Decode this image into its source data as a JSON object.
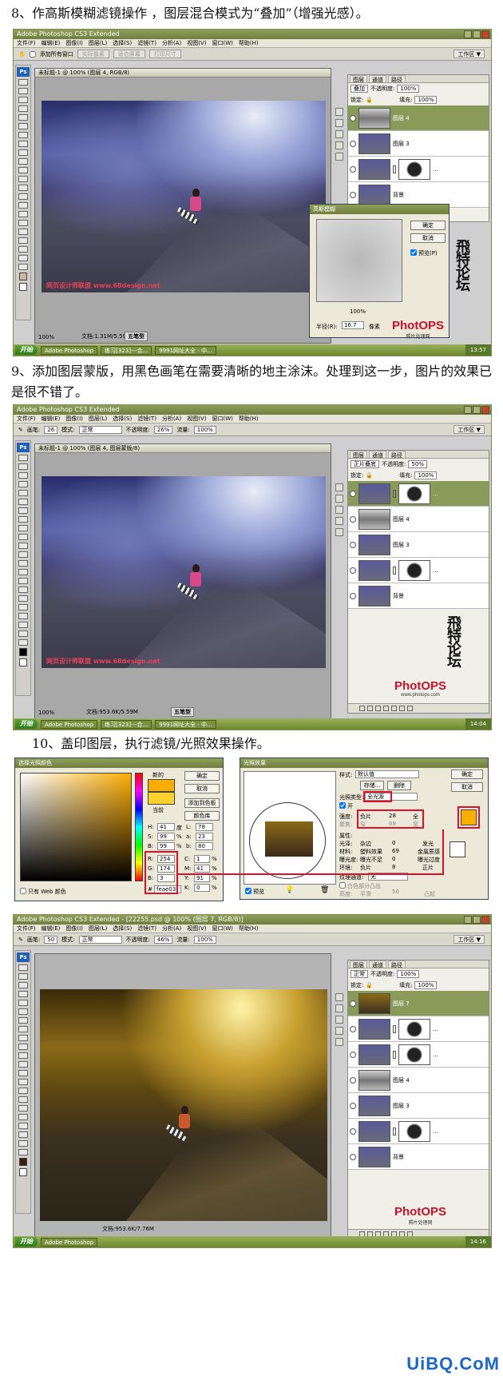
{
  "captions": {
    "step8": "8、作高斯模糊滤镜操作 ，图层混合模式为“叠加”（增强光感）。",
    "step9": "9、添加图层蒙版，用黑色画笔在需要清晰的地主涂沫。处理到这一步，图片的效果已是很不错了。",
    "step10": "10、盖印图层，执行滤镜/光照效果操作。"
  },
  "app": {
    "title": "Adobe Photoshop CS3 Extended",
    "title4": "Adobe Photoshop CS3 Extended - [22255.psd @ 100% (图层 7, RGB/8)]",
    "menu": [
      "文件(F)",
      "编辑(E)",
      "图像(I)",
      "图层(L)",
      "选择(S)",
      "滤镜(T)",
      "分析(A)",
      "视图(V)",
      "窗口(W)",
      "帮助(H)"
    ],
    "workspace": "工作区 ▼",
    "ps_logo": "Ps"
  },
  "shot1": {
    "options": {
      "checkbox": "添加所有窗口",
      "btn1": "实际像素",
      "btn2": "适合屏幕",
      "btn3": "打印尺寸"
    },
    "doc_title": "未标题-1 @ 100% (图层 4, RGB/8)",
    "zoom": "100%",
    "doc_status": "文档:1.31M/5.59M",
    "nav": "五笔型",
    "watermark": "网页设计师联盟 www.68design.net",
    "layers": {
      "tabs": [
        "图层",
        "通道",
        "路径"
      ],
      "blend": "叠加",
      "opacity_label": "不透明度:",
      "opacity": "100%",
      "lock_label": "锁定:",
      "fill_label": "填充:",
      "fill": "100%",
      "items": [
        {
          "name": "图层 4"
        },
        {
          "name": "图层 3"
        },
        {
          "name": "..."
        },
        {
          "name": "背景"
        }
      ]
    },
    "gauss": {
      "title": "高斯模糊",
      "ok": "确定",
      "cancel": "取消",
      "preview": "预览(P)",
      "zoom": "100%",
      "radius_label": "半径(R):",
      "radius": "16.7",
      "unit": "像素"
    },
    "taskbar": {
      "start": "开始",
      "tasks": [
        "Adobe Photoshop",
        "练习[323]---合...",
        "9991网址大全 - 中..."
      ],
      "clock": "13:57"
    }
  },
  "shot2": {
    "options": {
      "tool": "画笔:",
      "brush": "26",
      "mode_label": "模式:",
      "mode": "正常",
      "opacity_label": "不透明度:",
      "opacity": "26%",
      "flow_label": "流量:",
      "flow": "100%"
    },
    "doc_title": "未标题-1 @ 100% (图层 4, 图层蒙版/8)",
    "zoom": "100%",
    "doc_status": "文档:953.6K/5.59M",
    "nav": "五笔型",
    "watermark": "网页设计师联盟 www.68design.net",
    "layers": {
      "tabs": [
        "图层",
        "通道",
        "路径"
      ],
      "blend": "正片叠底",
      "opacity_label": "不透明度:",
      "opacity": "50%",
      "lock_label": "锁定:",
      "fill_label": "填充:",
      "fill": "100%",
      "items": [
        {
          "name": "..."
        },
        {
          "name": "图层 4"
        },
        {
          "name": "图层 3"
        },
        {
          "name": "..."
        },
        {
          "name": "背景"
        }
      ]
    },
    "taskbar": {
      "start": "开始",
      "tasks": [
        "Adobe Photoshop",
        "练习[323]---合...",
        "9991网址大全 - 中..."
      ],
      "clock": "14:04"
    }
  },
  "shot3": {
    "picker": {
      "title": "选择光照颜色",
      "new_label": "新的",
      "current_label": "当前",
      "ok": "确定",
      "cancel": "取消",
      "add_swatch": "添加到色板",
      "libraries": "颜色库",
      "web_only": "只有 Web 颜色",
      "h_label": "H:",
      "h": "41",
      "h_unit": "度",
      "s_label": "S:",
      "s": "99",
      "s_unit": "%",
      "b_label": "B:",
      "b": "99",
      "b_unit": "%",
      "r_label": "R:",
      "r": "254",
      "g_label": "G:",
      "g": "174",
      "bb_label": "B:",
      "bb": "3",
      "l_label": "L:",
      "l": "78",
      "a_label": "a:",
      "a": "23",
      "b2_label": "b:",
      "b2": "80",
      "c_label": "C:",
      "c": "1",
      "c_unit": "%",
      "m_label": "M:",
      "m": "41",
      "m_unit": "%",
      "y_label": "Y:",
      "y": "91",
      "y_unit": "%",
      "k_label": "K:",
      "k": "0",
      "k_unit": "%",
      "hex": "feae03",
      "new_color": "#feae03",
      "current_color": "#ffd230"
    },
    "lighting": {
      "title": "光照效果",
      "style_label": "样式:",
      "style": "默认值",
      "ok": "确定",
      "cancel": "取消",
      "save": "存储...",
      "delete": "删除",
      "light_type_label": "光照类型:",
      "light_type": "全光源",
      "on_label": "开",
      "intensity_label": "强度:",
      "intensity_neg": "负片",
      "intensity": "28",
      "intensity_pos": "全",
      "focus_label": "聚焦:",
      "focus_left": "窄",
      "focus": "69",
      "focus_right": "宽",
      "props_label": "属性:",
      "gloss_label": "光泽:",
      "gloss_left": "杂边",
      "gloss": "0",
      "gloss_right": "发光",
      "material_label": "材料:",
      "material_left": "塑料效果",
      "material": "69",
      "material_right": "金属质感",
      "exposure_label": "曝光度:",
      "exposure_left": "曝光不足",
      "exposure": "0",
      "exposure_right": "曝光过度",
      "ambience_label": "环境:",
      "ambience_left": "负片",
      "ambience": "8",
      "ambience_right": "正片",
      "texture_label": "纹理通道:",
      "texture": "无",
      "white_high": "白色部分凸出",
      "height_label": "高度:",
      "height_left": "平滑",
      "height": "50",
      "height_right": "凸起",
      "preview": "预览",
      "light_color": "#feae03"
    }
  },
  "shot4": {
    "options": {
      "tool": "画笔:",
      "brush": "50",
      "mode_label": "模式:",
      "mode": "正常",
      "opacity_label": "不透明度:",
      "opacity": "46%",
      "flow_label": "流量:",
      "flow": "100%"
    },
    "doc_status": "文档:953.6K/7.76M",
    "layers": {
      "tabs": [
        "图层",
        "通道",
        "路径"
      ],
      "blend": "正常",
      "opacity_label": "不透明度:",
      "opacity": "100%",
      "lock_label": "锁定:",
      "fill_label": "填充:",
      "fill": "100%",
      "items": [
        {
          "name": "图层 7"
        },
        {
          "name": "..."
        },
        {
          "name": "..."
        },
        {
          "name": "图层 4"
        },
        {
          "name": "图层 3"
        },
        {
          "name": "..."
        },
        {
          "name": "背景"
        }
      ]
    },
    "taskbar": {
      "start": "开始",
      "tasks": [
        "Adobe Photoshop"
      ],
      "clock": "14:16"
    }
  },
  "brand": {
    "calligraphy": "飛特论坛",
    "photops": "PhotOPS",
    "photops_sub1": "照片处理网",
    "photops_sub2": "www.photops.com",
    "site_logo": "UiBQ.CoM"
  }
}
